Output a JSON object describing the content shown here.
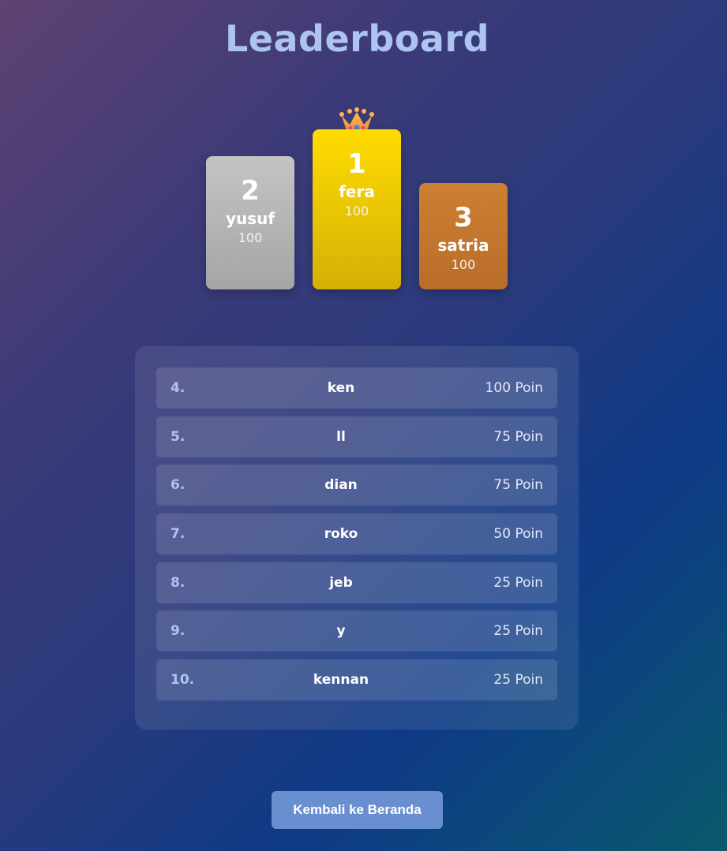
{
  "header": {
    "title": "Leaderboard"
  },
  "podium": {
    "first": {
      "rank": "1",
      "name": "fera",
      "score": "100"
    },
    "second": {
      "rank": "2",
      "name": "yusuf",
      "score": "100"
    },
    "third": {
      "rank": "3",
      "name": "satria",
      "score": "100"
    },
    "crown_icon": "crown-icon"
  },
  "list": {
    "rows": [
      {
        "rank": "4.",
        "name": "ken",
        "score": "100 Poin"
      },
      {
        "rank": "5.",
        "name": "ll",
        "score": "75 Poin"
      },
      {
        "rank": "6.",
        "name": "dian",
        "score": "75 Poin"
      },
      {
        "rank": "7.",
        "name": "roko",
        "score": "50 Poin"
      },
      {
        "rank": "8.",
        "name": "jeb",
        "score": "25 Poin"
      },
      {
        "rank": "9.",
        "name": "y",
        "score": "25 Poin"
      },
      {
        "rank": "10.",
        "name": "kennan",
        "score": "25 Poin"
      }
    ]
  },
  "footer": {
    "back_label": "Kembali ke Beranda"
  },
  "colors": {
    "gold": "#ffdc00",
    "silver": "#c4c4c4",
    "bronze": "#cd7f32",
    "button": "#6a8fd0",
    "title": "#aec4f0"
  }
}
